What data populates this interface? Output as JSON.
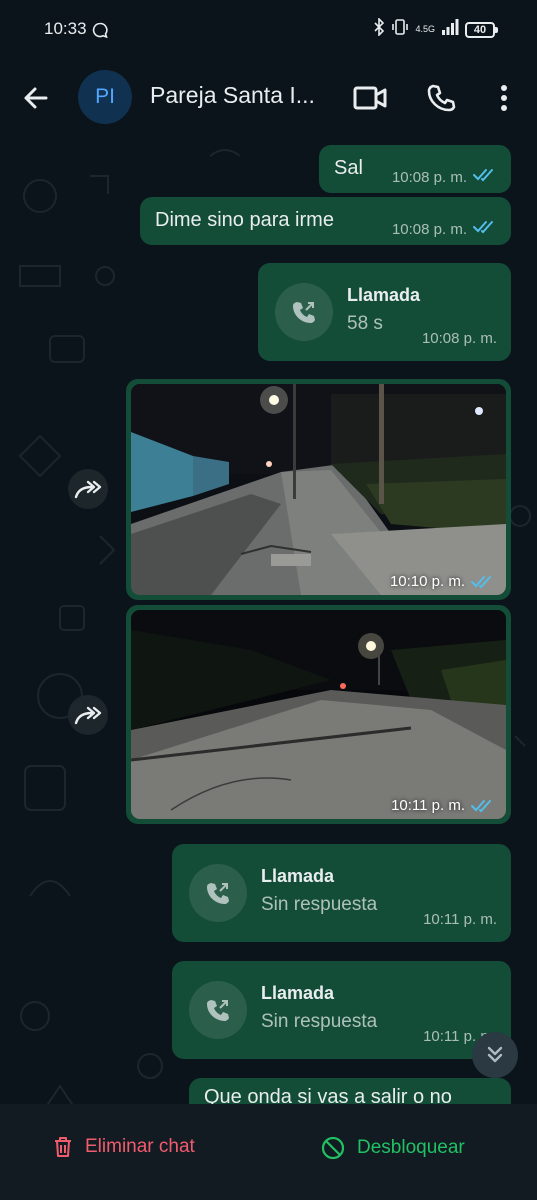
{
  "status_bar": {
    "time": "10:33",
    "network": "4.5G",
    "battery": "40"
  },
  "header": {
    "avatar_initials": "PI",
    "title": "Pareja Santa I...",
    "icons": [
      "back-arrow-icon",
      "video-call-icon",
      "voice-call-icon",
      "more-vert-icon"
    ]
  },
  "messages": [
    {
      "type": "text",
      "text": "Sal",
      "time": "10:08 p. m.",
      "status": "read"
    },
    {
      "type": "text",
      "text": "Dime sino para irme",
      "time": "10:08 p. m.",
      "status": "read"
    },
    {
      "type": "call",
      "title": "Llamada",
      "detail": "58 s",
      "time": "10:08 p. m."
    },
    {
      "type": "image",
      "time": "10:10 p. m.",
      "status": "read",
      "forward_icon": "forward-icon"
    },
    {
      "type": "image",
      "time": "10:11 p. m.",
      "status": "read",
      "forward_icon": "forward-icon"
    },
    {
      "type": "call",
      "title": "Llamada",
      "detail": "Sin respuesta",
      "time": "10:11 p. m."
    },
    {
      "type": "call",
      "title": "Llamada",
      "detail": "Sin respuesta",
      "time": "10:11 p. m."
    },
    {
      "type": "text",
      "text": "Que onda si vas a salir o no"
    }
  ],
  "bottom_actions": {
    "delete_label": "Eliminar chat",
    "unblock_label": "Desbloquear"
  },
  "colors": {
    "background": "#0b141a",
    "outgoing_bubble": "#134d37",
    "read_ticks": "#53bdeb",
    "delete": "#f15c6d",
    "unblock": "#21c063"
  }
}
